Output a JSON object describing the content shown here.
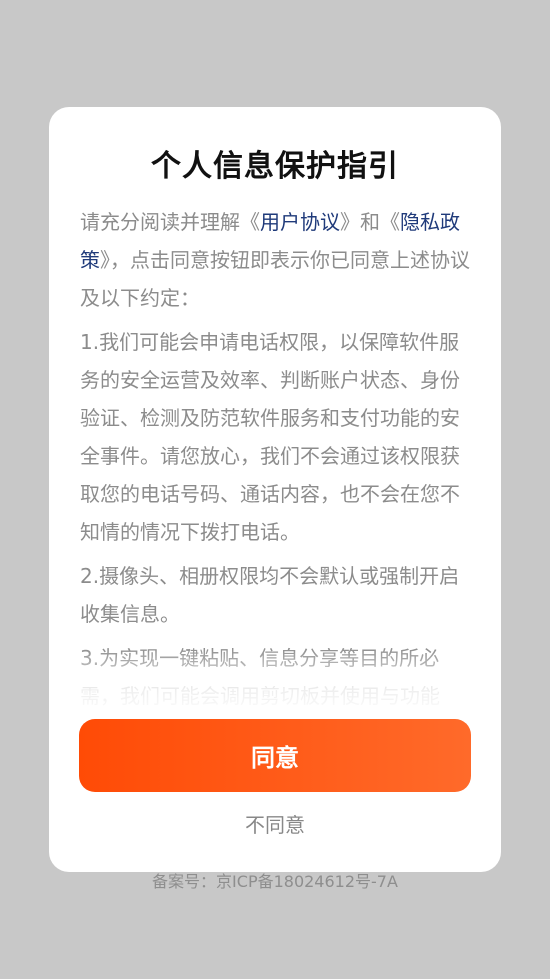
{
  "dialog": {
    "title": "个人信息保护指引",
    "intro": {
      "prefix": "请充分阅读并理解《",
      "user_agreement": "用户协议",
      "middle": "》和《",
      "privacy_policy": "隐私政策",
      "suffix": "》，点击同意按钮即表示你已同意上述协议及以下约定："
    },
    "paragraphs": [
      "1.我们可能会申请电话权限，以保障软件服务的安全运营及效率、判断账户状态、身份验证、检测及防范软件服务和支付功能的安全事件。请您放心，我们不会通过该权限获取您的电话号码、通话内容，也不会在您不知情的情况下拨打电话。",
      "2.摄像头、相册权限均不会默认或强制开启收集信息。",
      "3.为实现一键粘贴、信息分享等目的所必需，我们可能会调用剪切板并使用与功能"
    ],
    "agree_label": "同意",
    "disagree_label": "不同意"
  },
  "footer": {
    "icp": "备案号：京ICP备18024612号-7A"
  },
  "colors": {
    "backdrop": "#c8c8c8",
    "accent": "#ff5010",
    "link": "#1f3a7a",
    "body_text": "#8c8c8c"
  }
}
